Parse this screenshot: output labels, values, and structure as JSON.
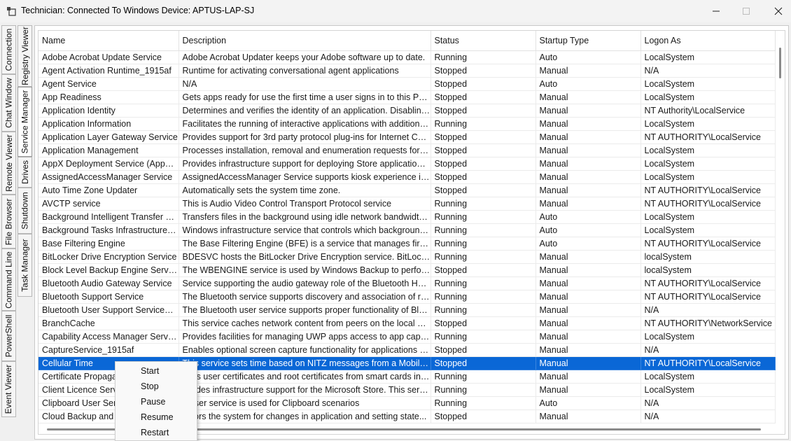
{
  "window": {
    "title": "Technician: Connected To Windows Device: APTUS-LAP-SJ",
    "icons": [
      "app-icon",
      "minimize-icon",
      "maximize-icon",
      "close-icon"
    ]
  },
  "left_tabs": {
    "outer": [
      "Connection",
      "Chat Window",
      "Remote Viewer",
      "File Browser",
      "Command Line",
      "PowerShell",
      "Event Viewer"
    ],
    "inner": [
      "Registry Viewer",
      "Service Manager",
      "Drives",
      "Shutdown",
      "Task Manager"
    ],
    "active": "Service Manager"
  },
  "table": {
    "columns": [
      "Name",
      "Description",
      "Status",
      "Startup Type",
      "Logon As"
    ],
    "rows": [
      [
        "Adobe Acrobat Update Service",
        "Adobe Acrobat Updater keeps your Adobe software up to date.",
        "Running",
        "Auto",
        "LocalSystem"
      ],
      [
        "Agent Activation Runtime_1915af",
        "Runtime for activating conversational agent applications",
        "Stopped",
        "Manual",
        "N/A"
      ],
      [
        "Agent Service",
        "N/A",
        "Stopped",
        "Auto",
        "LocalSystem"
      ],
      [
        "App Readiness",
        "Gets apps ready for use the first time a user signs in to this PC an...",
        "Stopped",
        "Manual",
        "LocalSystem"
      ],
      [
        "Application Identity",
        "Determines and verifies the identity of an application. Disabling ...",
        "Stopped",
        "Manual",
        "NT Authority\\LocalService"
      ],
      [
        "Application Information",
        "Facilitates the running of interactive applications with additional...",
        "Running",
        "Manual",
        "LocalSystem"
      ],
      [
        "Application Layer Gateway Service",
        "Provides support for 3rd party protocol plug-ins for Internet Con...",
        "Stopped",
        "Manual",
        "NT AUTHORITY\\LocalService"
      ],
      [
        "Application Management",
        "Processes installation, removal and enumeration requests for sof...",
        "Stopped",
        "Manual",
        "LocalSystem"
      ],
      [
        "AppX Deployment Service (AppXS...",
        "Provides infrastructure support for deploying Store applications....",
        "Stopped",
        "Manual",
        "LocalSystem"
      ],
      [
        "AssignedAccessManager Service",
        "AssignedAccessManager Service supports kiosk experience in Wi...",
        "Stopped",
        "Manual",
        "LocalSystem"
      ],
      [
        "Auto Time Zone Updater",
        "Automatically sets the system time zone.",
        "Stopped",
        "Manual",
        "NT AUTHORITY\\LocalService"
      ],
      [
        "AVCTP service",
        "This is Audio Video Control Transport Protocol service",
        "Running",
        "Manual",
        "NT AUTHORITY\\LocalService"
      ],
      [
        "Background Intelligent Transfer Se...",
        "Transfers files in the background using idle network bandwidth. ...",
        "Running",
        "Auto",
        "LocalSystem"
      ],
      [
        "Background Tasks Infrastructure S...",
        "Windows infrastructure service that controls which background ...",
        "Running",
        "Auto",
        "LocalSystem"
      ],
      [
        "Base Filtering Engine",
        "The Base Filtering Engine (BFE) is a service that manages firewall...",
        "Running",
        "Auto",
        "NT AUTHORITY\\LocalService"
      ],
      [
        "BitLocker Drive Encryption Service",
        "BDESVC hosts the BitLocker Drive Encryption service. BitLocker ...",
        "Running",
        "Manual",
        "localSystem"
      ],
      [
        "Block Level Backup Engine Service",
        "The WBENGINE service is used by Windows Backup to perform ...",
        "Stopped",
        "Manual",
        "localSystem"
      ],
      [
        "Bluetooth Audio Gateway Service",
        "Service supporting the audio gateway role of the Bluetooth Han...",
        "Running",
        "Manual",
        "NT AUTHORITY\\LocalService"
      ],
      [
        "Bluetooth Support Service",
        "The Bluetooth service supports discovery and association of rem...",
        "Running",
        "Manual",
        "NT AUTHORITY\\LocalService"
      ],
      [
        "Bluetooth User Support Service_19...",
        "The Bluetooth user service supports proper functionality of Blue...",
        "Running",
        "Manual",
        "N/A"
      ],
      [
        "BranchCache",
        "This service caches network content from peers on the local sub...",
        "Stopped",
        "Manual",
        "NT AUTHORITY\\NetworkService"
      ],
      [
        "Capability Access Manager Service",
        "Provides facilities for managing UWP apps access to app capabil...",
        "Running",
        "Manual",
        "LocalSystem"
      ],
      [
        "CaptureService_1915af",
        "Enables optional screen capture functionality for applications th...",
        "Stopped",
        "Manual",
        "N/A"
      ],
      [
        "Cellular Time",
        "This service sets time based on NITZ messages from a Mobile N...",
        "Stopped",
        "Manual",
        "NT AUTHORITY\\LocalService"
      ],
      [
        "Certificate Propagat...",
        "...ies user certificates and root certificates from smart cards int...",
        "Running",
        "Manual",
        "LocalSystem"
      ],
      [
        "Client Licence Servic...",
        "...vides infrastructure support for the Microsoft Store. This serv...",
        "Running",
        "Manual",
        "LocalSystem"
      ],
      [
        "Clipboard User Servi...",
        "...user service is used for Clipboard scenarios",
        "Running",
        "Auto",
        "N/A"
      ],
      [
        "Cloud Backup and R...",
        "...itors the system for changes in application and setting state...",
        "Stopped",
        "Manual",
        "N/A"
      ]
    ],
    "selected_index": 23,
    "colors": {
      "selection": "#0a67d6",
      "selection_text": "#ffffff"
    }
  },
  "context_menu": {
    "items": [
      "Start",
      "Stop",
      "Pause",
      "Resume",
      "Restart"
    ]
  }
}
